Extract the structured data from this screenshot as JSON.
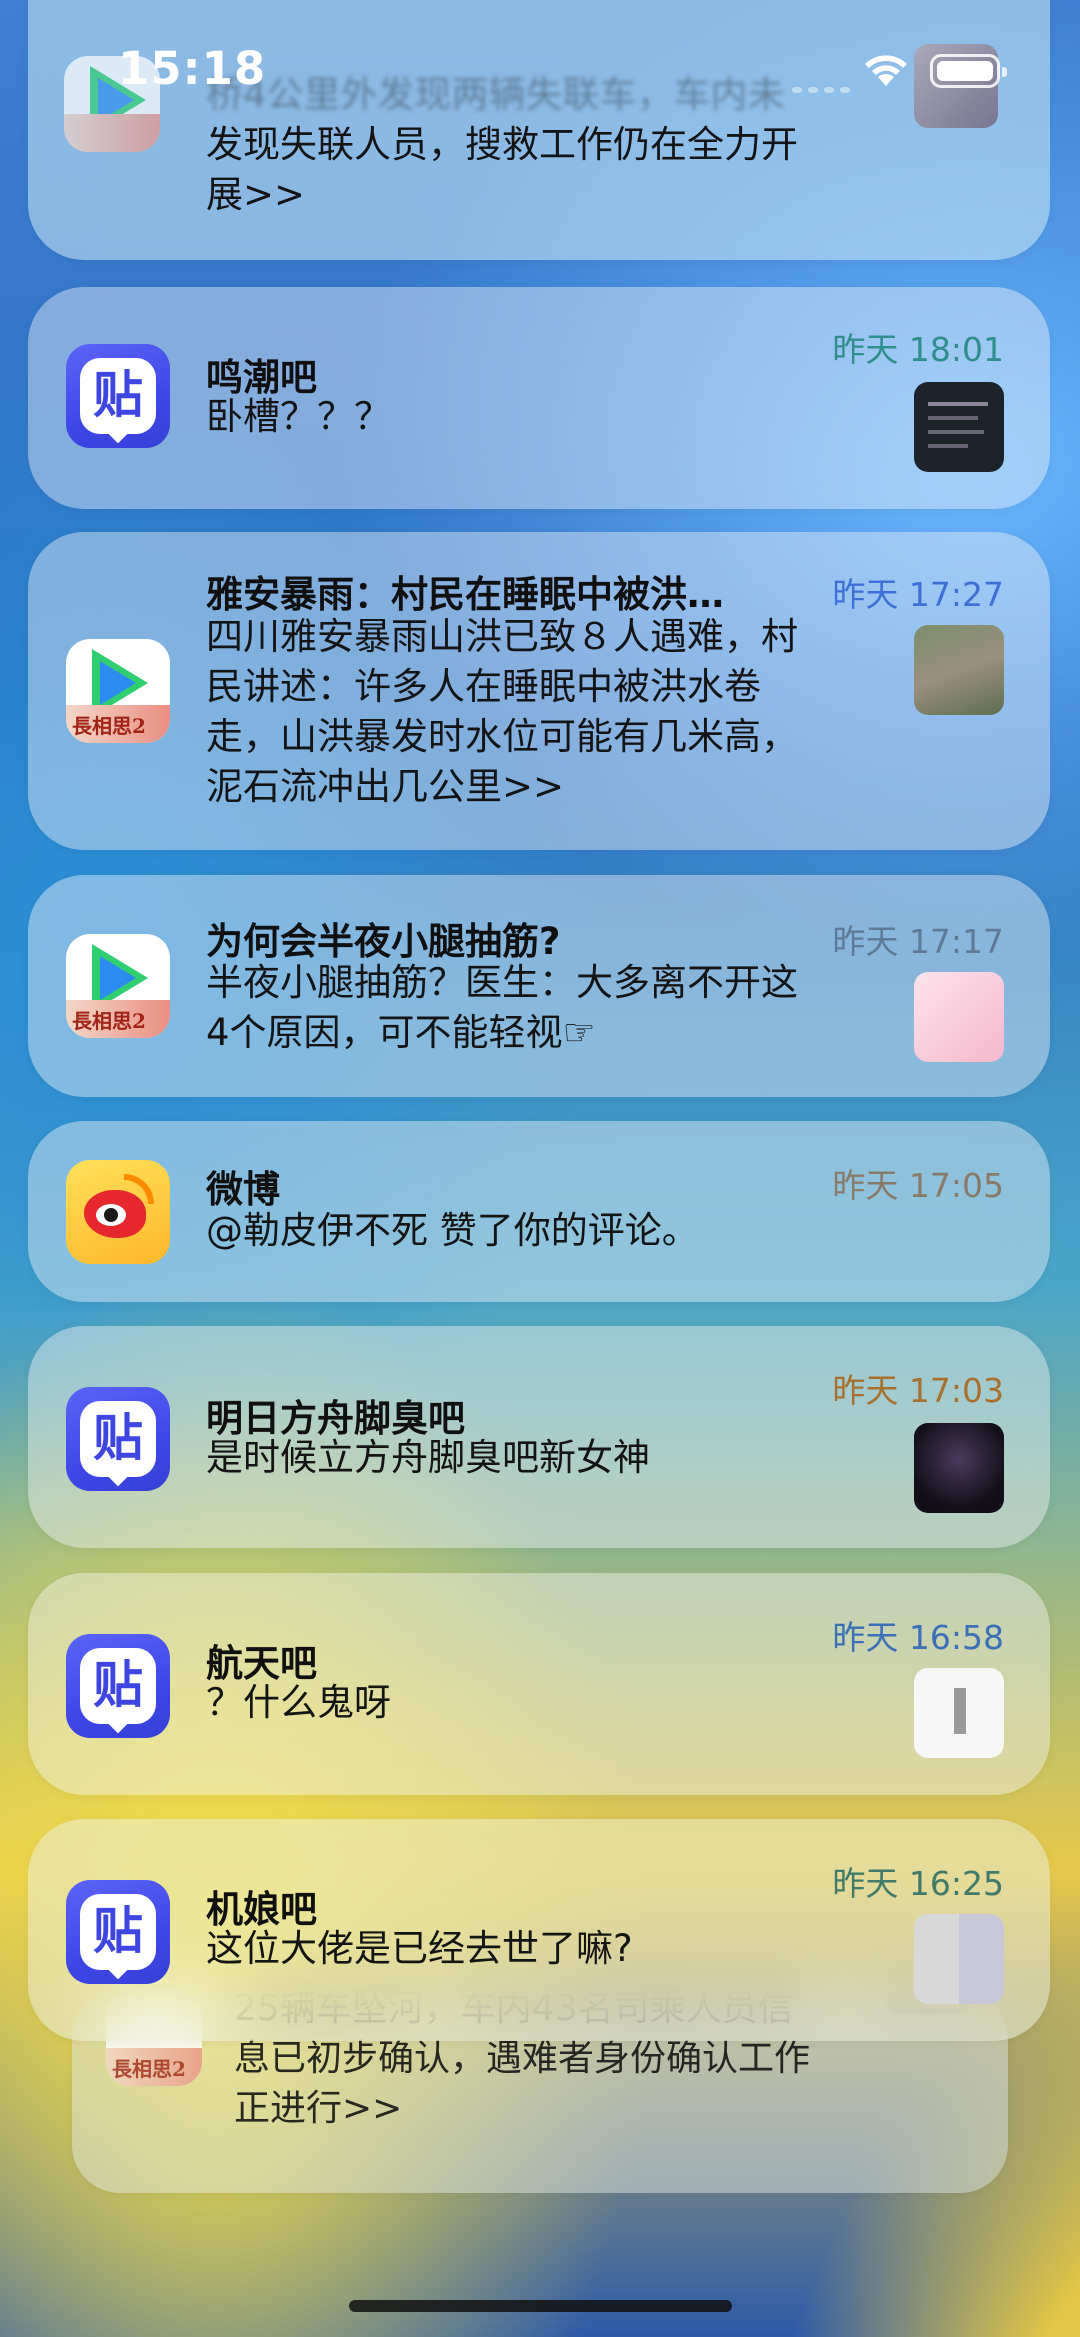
{
  "status_bar": {
    "time": "15:18"
  },
  "top_card": {
    "message": "发现失联人员，搜救工作仍在全力开\n展>>",
    "blur_line": "桥4公里外发现两辆失联车，车内未"
  },
  "notifications": [
    {
      "app": "tieba",
      "title": "鸣潮吧",
      "message": "卧槽？？？",
      "time": "昨天 18:01",
      "time_color": "#2f8f8c"
    },
    {
      "app": "video",
      "title": "雅安暴雨：村民在睡眠中被洪…",
      "message": "四川雅安暴雨山洪已致８人遇难，村\n民讲述：许多人在睡眠中被洪水卷\n走，山洪暴发时水位可能有几米高，\n泥石流冲出几公里>>",
      "time": "昨天 17:27",
      "time_color": "#3f6fd8"
    },
    {
      "app": "video",
      "title": "为何会半夜小腿抽筋?",
      "message": "半夜小腿抽筋？医生：大多离不开这\n4个原因，可不能轻视☞",
      "time": "昨天 17:17",
      "time_color": "#5f7a96"
    },
    {
      "app": "weibo",
      "title": "微博",
      "message": "@勒皮伊不死 赞了你的评论。",
      "time": "昨天 17:05",
      "time_color": "#8a7a6a"
    },
    {
      "app": "tieba",
      "title": "明日方舟脚臭吧",
      "message": "是时候立方舟脚臭吧新女神",
      "time": "昨天 17:03",
      "time_color": "#a8702c"
    },
    {
      "app": "tieba",
      "title": "航天吧",
      "message": "？什么鬼呀",
      "time": "昨天 16:58",
      "time_color": "#3b6fb8"
    },
    {
      "app": "tieba",
      "title": "机娘吧",
      "message": "这位大佬是已经去世了嘛?",
      "time": "昨天 16:25",
      "time_color": "#3f7a6a"
    }
  ],
  "behind_card": {
    "message": "25辆车坠河，车内43名司乘人员信\n息已初步确认，遇难者身份确认工作\n正进行>>"
  },
  "video_icon_banner": "長相思2",
  "tieba_icon_char": "贴"
}
